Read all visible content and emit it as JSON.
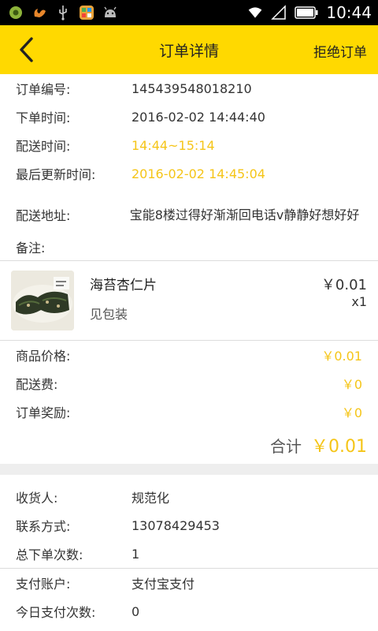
{
  "status_bar": {
    "time": "10:44",
    "left_icons": [
      "notification-icon",
      "squirrel-app-icon",
      "usb-icon",
      "app-grid-icon",
      "android-icon"
    ],
    "right_icons": [
      "wifi-icon",
      "signal-icon",
      "battery-icon"
    ]
  },
  "header": {
    "title": "订单详情",
    "reject_label": "拒绝订单",
    "background": "#ffd900"
  },
  "order": {
    "number_label": "订单编号:",
    "number": "145439548018210",
    "placed_label": "下单时间:",
    "placed": "2016-02-02 14:44:40",
    "delivery_time_label": "配送时间:",
    "delivery_time": "14:44~15:14",
    "updated_label": "最后更新时间:",
    "updated": "2016-02-02 14:45:04",
    "address_label": "配送地址:",
    "address": "宝能8楼过得好渐渐回电话v静静好想好好",
    "note_label": "备注:",
    "note": ""
  },
  "product": {
    "name": "海苔杏仁片",
    "spec": "见包装",
    "price": "￥0.01",
    "qty": "x1"
  },
  "fees": {
    "goods_label": "商品价格:",
    "goods": "￥0.01",
    "delivery_label": "配送费:",
    "delivery": "￥0",
    "reward_label": "订单奖励:",
    "reward": "￥0",
    "total_label": "合计",
    "total": "￥0.01"
  },
  "customer": {
    "receiver_label": "收货人:",
    "receiver": "规范化",
    "contact_label": "联系方式:",
    "contact": "13078429453",
    "orders_label": "总下单次数:",
    "orders": "1",
    "pay_account_label": "支付账户:",
    "pay_account": "支付宝支付",
    "today_pay_label": "今日支付次数:",
    "today_pay": "0"
  },
  "accent_color": "#f5c518"
}
